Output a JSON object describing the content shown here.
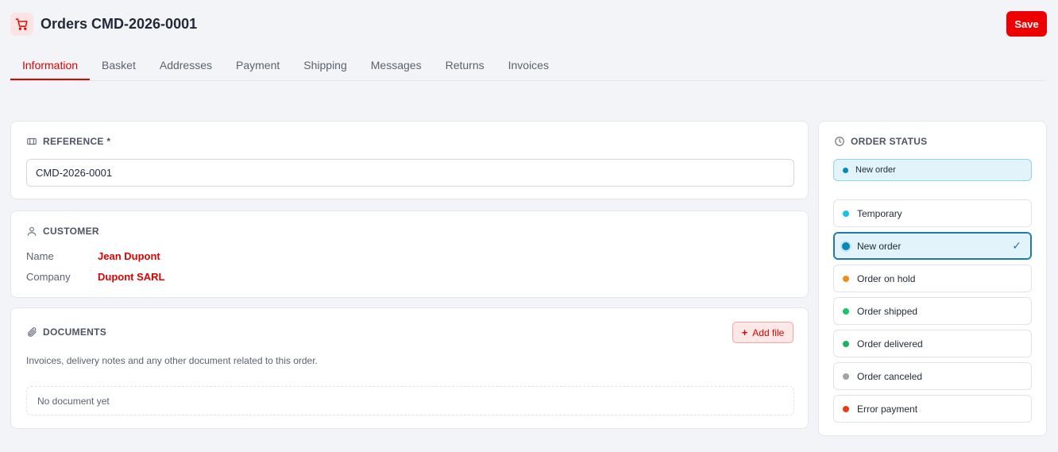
{
  "header": {
    "title": "Orders CMD-2026-0001",
    "save_label": "Save",
    "icon": "shopping-cart-icon"
  },
  "tabs": [
    {
      "label": "Information",
      "active": true
    },
    {
      "label": "Basket"
    },
    {
      "label": "Addresses"
    },
    {
      "label": "Payment"
    },
    {
      "label": "Shipping"
    },
    {
      "label": "Messages"
    },
    {
      "label": "Returns"
    },
    {
      "label": "Invoices"
    }
  ],
  "reference": {
    "title": "REFERENCE *",
    "value": "CMD-2026-0001"
  },
  "customer": {
    "title": "CUSTOMER",
    "name_label": "Name",
    "name_value": "Jean Dupont",
    "company_label": "Company",
    "company_value": "Dupont SARL"
  },
  "documents": {
    "title": "DOCUMENTS",
    "add_label": "Add file",
    "description": "Invoices, delivery notes and any other document related to this order.",
    "empty": "No document yet"
  },
  "order_status": {
    "title": "ORDER STATUS",
    "current": "New order",
    "current_color": "#0a86b8",
    "options": [
      {
        "label": "Temporary",
        "color": "#18c1ec"
      },
      {
        "label": "New order",
        "color": "#0a86b8",
        "selected": true
      },
      {
        "label": "Order on hold",
        "color": "#f08c1a"
      },
      {
        "label": "Order shipped",
        "color": "#1fc26b"
      },
      {
        "label": "Order delivered",
        "color": "#16b45c"
      },
      {
        "label": "Order canceled",
        "color": "#a3a3a3"
      },
      {
        "label": "Error payment",
        "color": "#f03a0e"
      }
    ],
    "check_glyph": "✓"
  },
  "colors": {
    "accent": "#e00000",
    "background": "#f3f4f7"
  }
}
